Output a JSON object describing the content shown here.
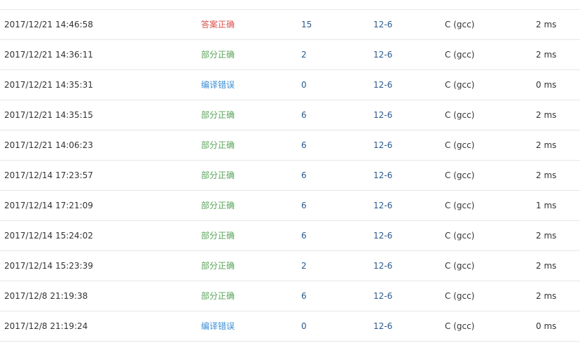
{
  "colors": {
    "accepted": "#d9534f",
    "partial": "#5aa55a",
    "compile_error": "#3a8fd6",
    "link": "#2a5a8c",
    "divider": "#e6e6e6"
  },
  "rows": [
    {
      "time": "2017/12/21 14:46:58",
      "status": "答案正确",
      "status_type": "accepted",
      "score": "15",
      "problem": "12-6",
      "lang": "C (gcc)",
      "mem": "2 ms"
    },
    {
      "time": "2017/12/21 14:36:11",
      "status": "部分正确",
      "status_type": "partial",
      "score": "2",
      "problem": "12-6",
      "lang": "C (gcc)",
      "mem": "2 ms"
    },
    {
      "time": "2017/12/21 14:35:31",
      "status": "编译错误",
      "status_type": "compile_error",
      "score": "0",
      "problem": "12-6",
      "lang": "C (gcc)",
      "mem": "0 ms"
    },
    {
      "time": "2017/12/21 14:35:15",
      "status": "部分正确",
      "status_type": "partial",
      "score": "6",
      "problem": "12-6",
      "lang": "C (gcc)",
      "mem": "2 ms"
    },
    {
      "time": "2017/12/21 14:06:23",
      "status": "部分正确",
      "status_type": "partial",
      "score": "6",
      "problem": "12-6",
      "lang": "C (gcc)",
      "mem": "2 ms"
    },
    {
      "time": "2017/12/14 17:23:57",
      "status": "部分正确",
      "status_type": "partial",
      "score": "6",
      "problem": "12-6",
      "lang": "C (gcc)",
      "mem": "2 ms"
    },
    {
      "time": "2017/12/14 17:21:09",
      "status": "部分正确",
      "status_type": "partial",
      "score": "6",
      "problem": "12-6",
      "lang": "C (gcc)",
      "mem": "1 ms"
    },
    {
      "time": "2017/12/14 15:24:02",
      "status": "部分正确",
      "status_type": "partial",
      "score": "6",
      "problem": "12-6",
      "lang": "C (gcc)",
      "mem": "2 ms"
    },
    {
      "time": "2017/12/14 15:23:39",
      "status": "部分正确",
      "status_type": "partial",
      "score": "2",
      "problem": "12-6",
      "lang": "C (gcc)",
      "mem": "2 ms"
    },
    {
      "time": "2017/12/8 21:19:38",
      "status": "部分正确",
      "status_type": "partial",
      "score": "6",
      "problem": "12-6",
      "lang": "C (gcc)",
      "mem": "2 ms"
    },
    {
      "time": "2017/12/8 21:19:24",
      "status": "编译错误",
      "status_type": "compile_error",
      "score": "0",
      "problem": "12-6",
      "lang": "C (gcc)",
      "mem": "0 ms"
    }
  ]
}
